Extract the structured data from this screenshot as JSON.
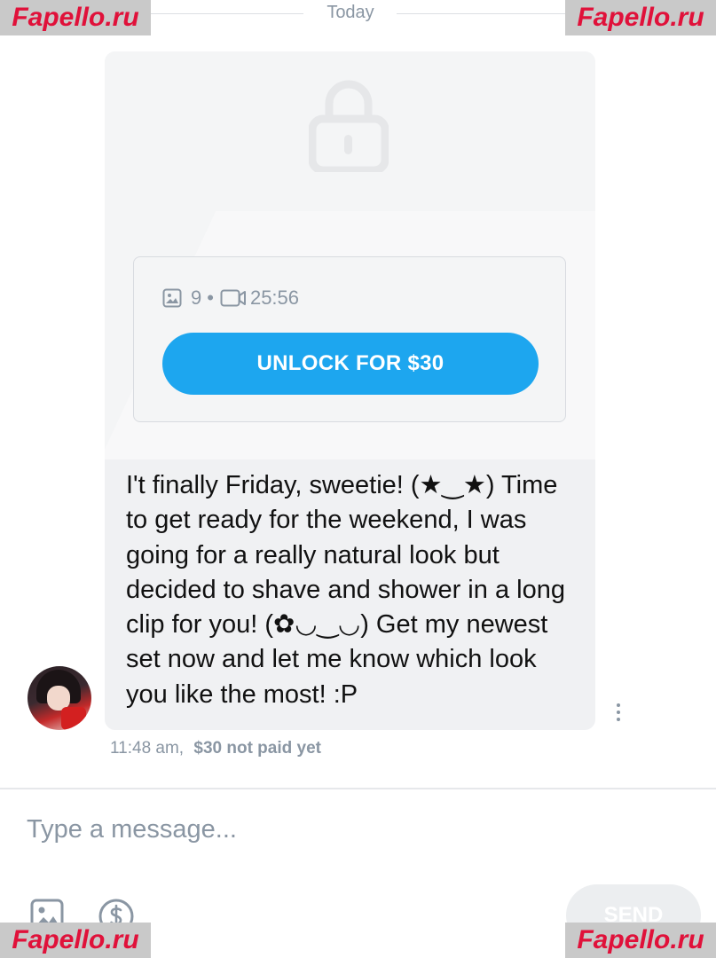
{
  "date_separator": {
    "label": "Today"
  },
  "locked_message": {
    "photo_count": "9",
    "separator": "•",
    "video_duration": "25:56",
    "unlock_label": "UNLOCK FOR $30"
  },
  "message": {
    "text": "I't finally Friday, sweetie! (★‿★) Time to get ready for the weekend, I was going for a really natural look but decided to shave and shower in a long clip for you! (✿◡‿◡) Get my newest set now and let me know which look you like the most! :P",
    "time": "11:48 am,",
    "price_status": "$30 not paid yet"
  },
  "composer": {
    "placeholder": "Type a message...",
    "send_label": "SEND"
  },
  "watermark": {
    "text": "Fapello.ru"
  },
  "colors": {
    "accent": "#1da6ef",
    "muted": "#8a96a3",
    "bubble": "#f0f1f3",
    "watermark_text": "#e0113a"
  },
  "icons": [
    "lock-icon",
    "image-icon",
    "video-icon",
    "more-icon",
    "attach-image-icon",
    "tip-dollar-icon"
  ]
}
